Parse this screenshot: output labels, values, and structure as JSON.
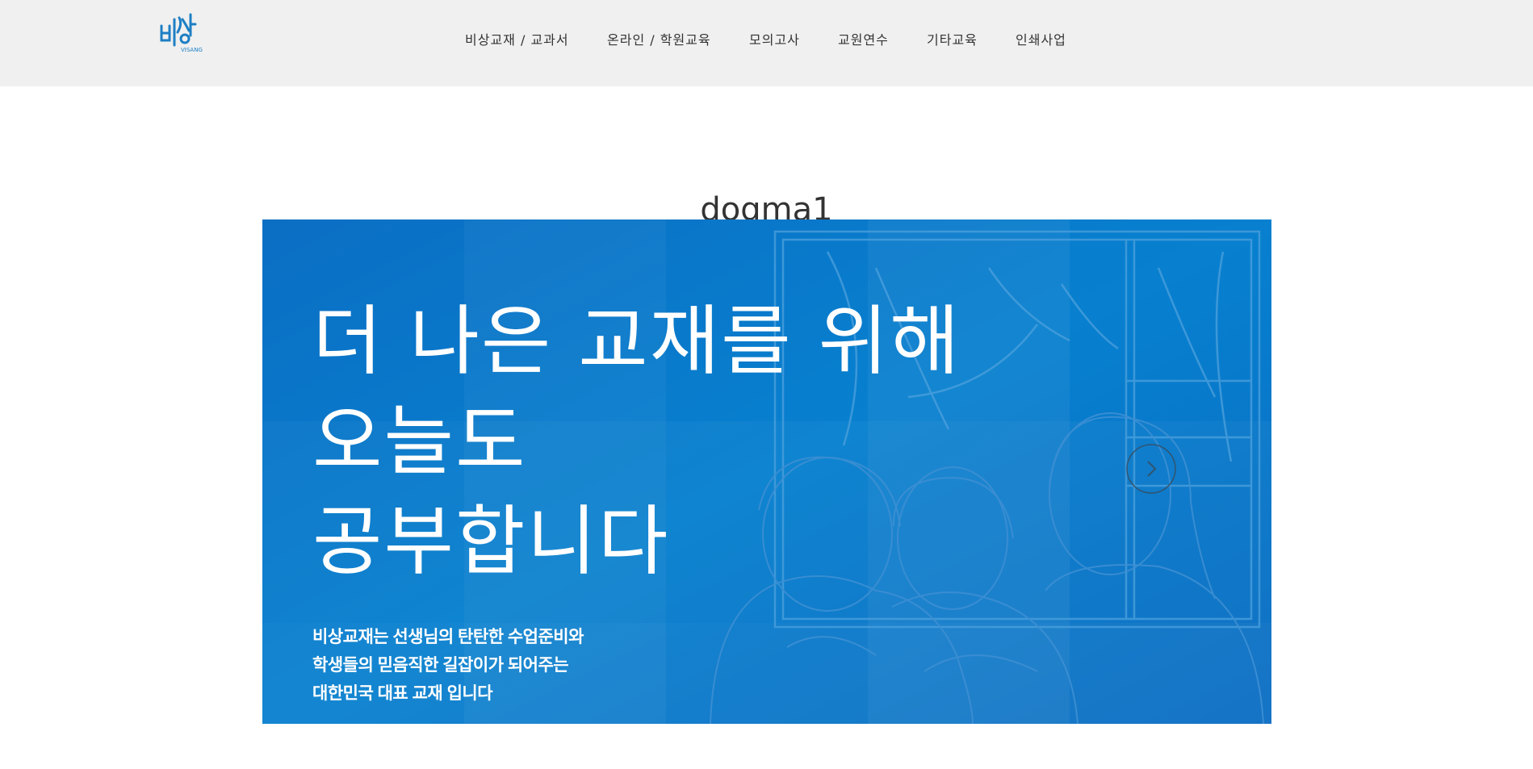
{
  "header": {
    "logo": {
      "text": "비상",
      "sub": "VISANG"
    },
    "nav": [
      "비상교재 / 교과서",
      "온라인 / 학원교육",
      "모의고사",
      "교원연수",
      "기타교육",
      "인쇄사업"
    ]
  },
  "slide": {
    "title": "dogma1",
    "headline": [
      "더 나은 교재를 위해",
      "오늘도",
      "공부합니다"
    ],
    "subtext": [
      "비상교재는 선생님의 탄탄한 수업준비와",
      "학생들의 믿음직한 길잡이가 되어주는",
      "대한민국 대표 교재 입니다"
    ]
  },
  "colors": {
    "brand": "#0a74c8",
    "header_bg": "#f0f0f0",
    "text": "#333333"
  },
  "icons": {
    "next": "chevron-right-icon"
  }
}
